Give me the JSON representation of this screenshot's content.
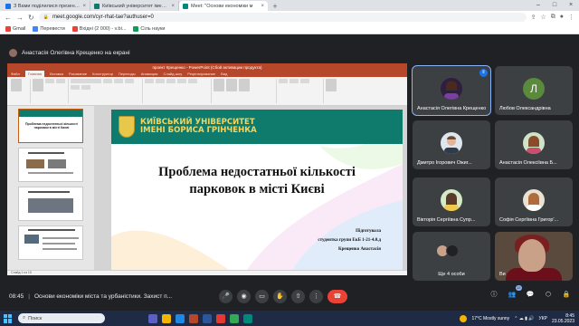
{
  "browser": {
    "tabs": [
      {
        "title": "З Вами поділилися презентаці",
        "color": "#1a73e8",
        "active": false
      },
      {
        "title": "Київський університет імені Бо",
        "color": "#0f7b6c",
        "active": false
      },
      {
        "title": "Meet: \"Основи економіки м",
        "color": "#00897b",
        "active": true
      }
    ],
    "url": "meet.google.com/cyr-rhat-tae?authuser=0",
    "bookmarks": [
      "Gmail",
      "Перевести",
      "Вхідні (2 000) - v.bi...",
      "Сіль науки"
    ]
  },
  "meet": {
    "presenter_banner": "Анастасія Олегівна Крещенко на екрані",
    "time": "08:45",
    "meeting_name": "Основи економіки міста та урбаністики. Захист п...",
    "participant_count": "12",
    "accent": "#8ab4f8",
    "end_call_color": "#ea4335",
    "participants": [
      {
        "name": "Анастасія Олегівна Крещенко",
        "speaking": true
      },
      {
        "name": "Любов Олександрівна",
        "initial": "Л"
      },
      {
        "name": "Дмитро Ігорович Ожиг..."
      },
      {
        "name": "Анастасія Олексіївна Б..."
      },
      {
        "name": "Вікторія Сергіївна Супр..."
      },
      {
        "name": "Софія Сергіївна Григор'..."
      },
      {
        "name": "Ще 4 особи"
      },
      {
        "name": "Ви"
      }
    ]
  },
  "presentation": {
    "window_title": "проект Крещенко - PowerPoint (Сбой активации продукта)",
    "ribbon_tabs": [
      "Файл",
      "Главная",
      "Вставка",
      "Рисование",
      "Конструктор",
      "Переходы",
      "Анимация",
      "Слайд-шоу",
      "Рецензирование",
      "Вид"
    ],
    "university": [
      "КИЇВСЬКИЙ УНІВЕРСИТЕТ",
      "ІМЕНІ БОРИСА ГРІНЧЕНКА"
    ],
    "title_lines": [
      "Проблема недостатньої кількості",
      "парковок в місті Києві"
    ],
    "author_lines": [
      "Підготувала",
      "студентка групи ЕкБ 1-21-4.0.д",
      "Крещенко Анастасія"
    ],
    "slide_numbers": [
      "1",
      "2",
      "3",
      "4"
    ],
    "status": "Слайд 1 из 15",
    "brand_green": "#0f7b6c"
  },
  "taskbar": {
    "search_label": "Поиск",
    "weather": "17°C  Mostly sunny",
    "lang": "УКР",
    "clock_time": "8:45",
    "clock_date": "23.05.2023"
  }
}
